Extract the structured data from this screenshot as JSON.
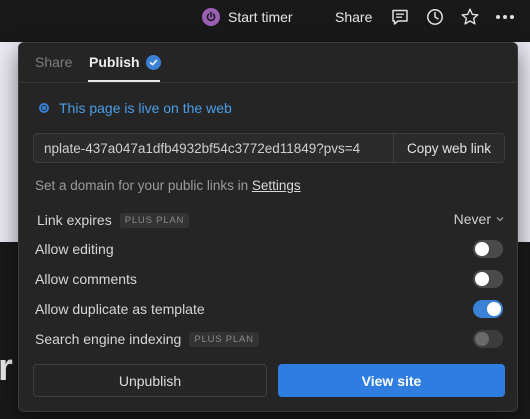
{
  "topbar": {
    "timer_label": "Start timer",
    "share_label": "Share",
    "icons": [
      "power-icon",
      "comment-icon",
      "history-icon",
      "star-icon",
      "more-icon"
    ]
  },
  "background": {
    "partial_letter": "r"
  },
  "popover": {
    "tabs": [
      {
        "label": "Share",
        "active": false
      },
      {
        "label": "Publish",
        "active": true
      }
    ],
    "live_status": "This page is live on the web",
    "url_value": "nplate-437a047a1dfb4932bf54c3772ed11849?pvs=4",
    "copy_button": "Copy web link",
    "domain_text": "Set a domain for your public links in ",
    "domain_link": "Settings",
    "options": {
      "link_expires": {
        "label": "Link expires",
        "badge": "PLUS PLAN",
        "value": "Never"
      },
      "allow_editing": {
        "label": "Allow editing",
        "on": false
      },
      "allow_comments": {
        "label": "Allow comments",
        "on": false
      },
      "allow_duplicate": {
        "label": "Allow duplicate as template",
        "on": true
      },
      "search_indexing": {
        "label": "Search engine indexing",
        "badge": "PLUS PLAN",
        "on": false,
        "disabled": true
      }
    },
    "unpublish_button": "Unpublish",
    "view_site_button": "View site"
  },
  "colors": {
    "accent": "#2f7de1",
    "live_text": "#4a9de8",
    "timer_icon": "#9a5fb5",
    "popover_bg": "#252525"
  }
}
